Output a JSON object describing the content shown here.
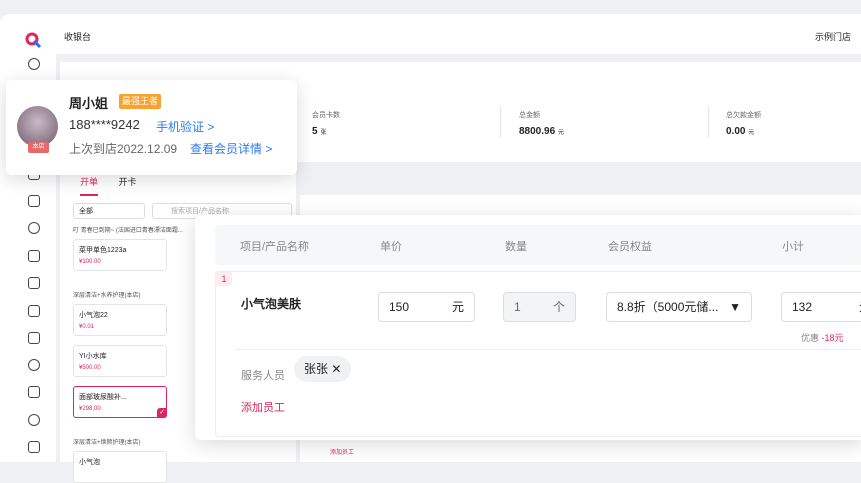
{
  "topbar": {
    "title": "收银台",
    "store": "示例门店"
  },
  "stats": [
    {
      "label": "会员卡数",
      "value": "5",
      "unit": "张"
    },
    {
      "label": "总金额",
      "value": "8800.96",
      "unit": "元"
    },
    {
      "label": "总欠款金额",
      "value": "0.00",
      "unit": "元"
    }
  ],
  "tabs": [
    {
      "label": "开单"
    },
    {
      "label": "开卡"
    }
  ],
  "filter": {
    "select_value": "全部",
    "search_placeholder": "搜索项目/产品名称"
  },
  "notes": [
    "叮 青春已到期~ (法国进口青春漂洁面霜...",
    "深层清洁+水养护理(本店)",
    "深层清洁+焕颜护理(本店)"
  ],
  "cards": [
    {
      "name": "菜甲单色1223a",
      "price": "¥100.00"
    },
    {
      "name": "小气泡22",
      "price": "¥0.01"
    },
    {
      "name": "YI小水库",
      "price": "¥500.00"
    },
    {
      "name": "面部玻尿酸补...",
      "price": "¥298.00"
    },
    {
      "name": "小气泡",
      "price": ""
    }
  ],
  "left_bottom_add": "添加员工",
  "member": {
    "name": "周小姐",
    "level": "最强王者",
    "phone": "188****9242",
    "verify_link": "手机验证 >",
    "last_visit": "上次到店2022.12.09",
    "detail_link": "查看会员详情 >",
    "avatar_badge": "本店"
  },
  "order": {
    "headers": [
      "项目/产品名称",
      "单价",
      "数量",
      "会员权益",
      "小计"
    ],
    "row_index": "1",
    "product": "小气泡美肤",
    "price": "150",
    "price_unit": "元",
    "qty": "1",
    "qty_unit": "个",
    "benefit": "8.8折（5000元储...",
    "subtotal": "132",
    "subtotal_unit": "元",
    "discount_label": "优惠",
    "discount_value": "-18元",
    "staff_label": "服务人员",
    "staff_chip": "张张",
    "add_staff": "添加员工"
  },
  "colors": {
    "accent": "#e0245e",
    "link": "#2b7bef",
    "badge": "#f6a332"
  }
}
